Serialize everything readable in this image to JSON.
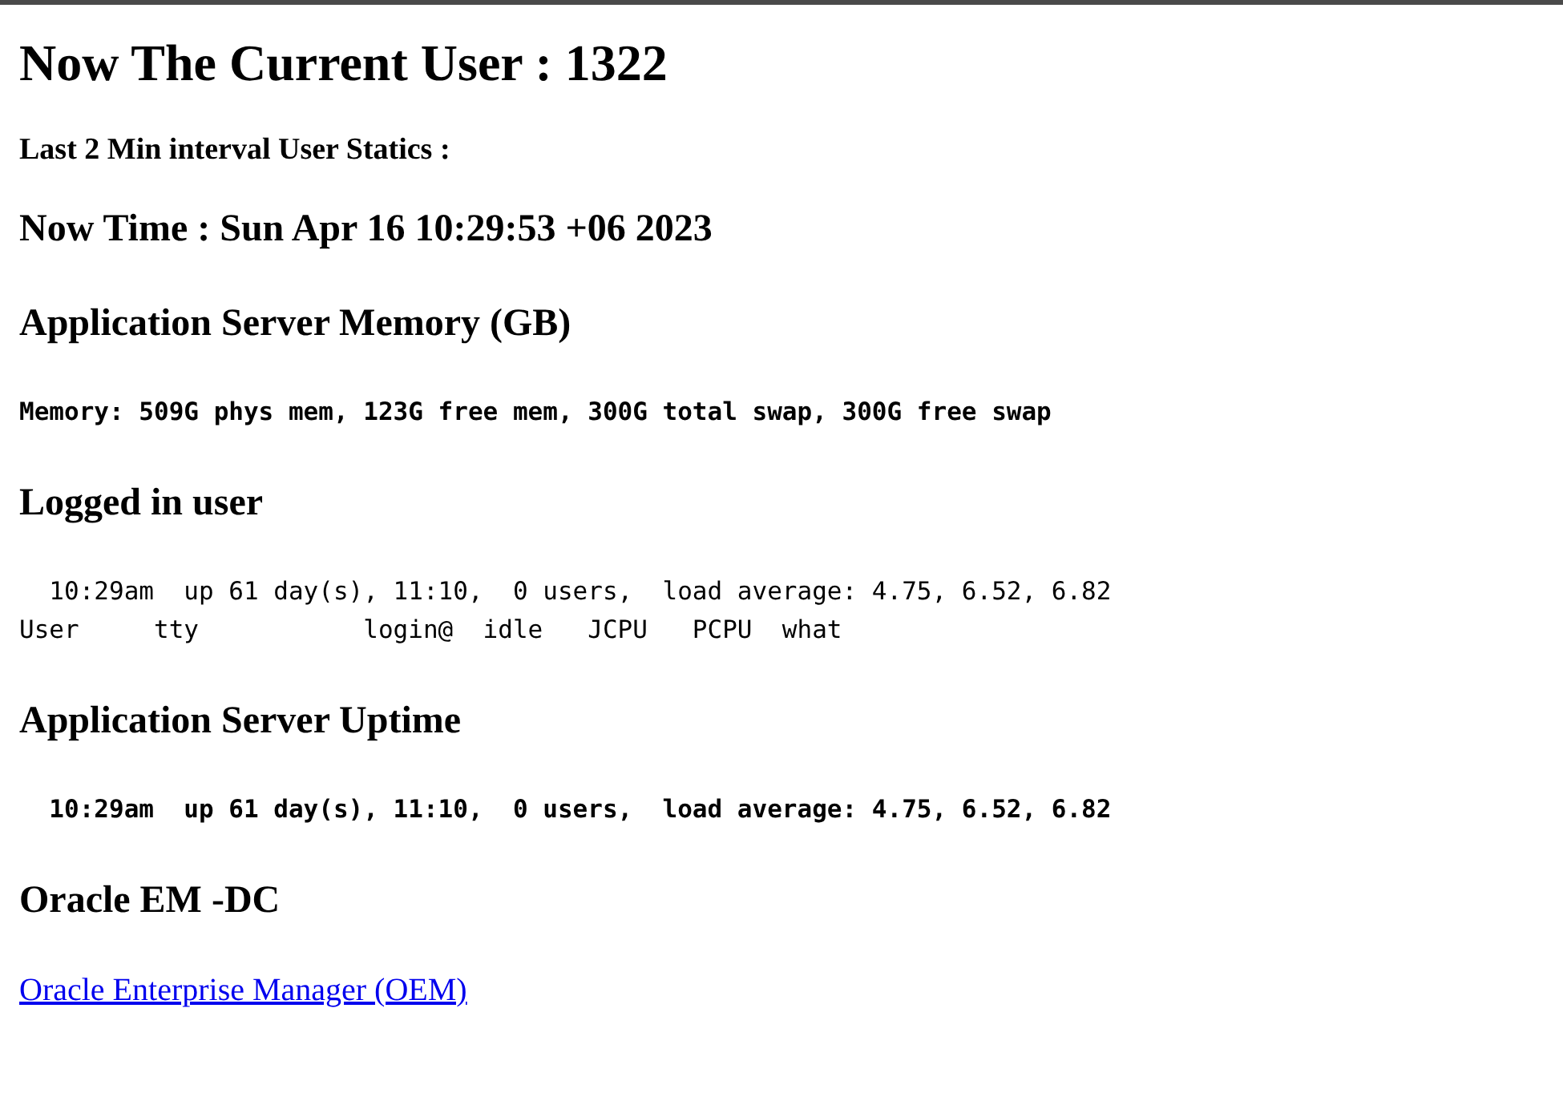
{
  "blocks": [
    {
      "kind": "title",
      "text": "Now The Current User : 1322"
    },
    {
      "kind": "subheading",
      "text": "Last 2 Min interval User Statics :"
    },
    {
      "kind": "heading",
      "text": "Now Time : Sun Apr 16 10:29:53 +06 2023"
    },
    {
      "kind": "heading",
      "text": "Application Server Memory (GB)"
    },
    {
      "kind": "output",
      "bold": true,
      "lines": [
        "Memory: 509G phys mem, 123G free mem, 300G total swap, 300G free swap"
      ]
    },
    {
      "kind": "heading",
      "text": "Logged in user"
    },
    {
      "kind": "output",
      "bold": false,
      "lines": [
        "  10:29am  up 61 day(s), 11:10,  0 users,  load average: 4.75, 6.52, 6.82",
        "User     tty           login@  idle   JCPU   PCPU  what"
      ]
    },
    {
      "kind": "heading",
      "text": "Application Server Uptime"
    },
    {
      "kind": "output",
      "bold": true,
      "lines": [
        "  10:29am  up 61 day(s), 11:10,  0 users,  load average: 4.75, 6.52, 6.82"
      ]
    },
    {
      "kind": "heading",
      "text": "Oracle EM -DC"
    },
    {
      "kind": "link",
      "text": "Oracle Enterprise Manager (OEM)"
    }
  ]
}
